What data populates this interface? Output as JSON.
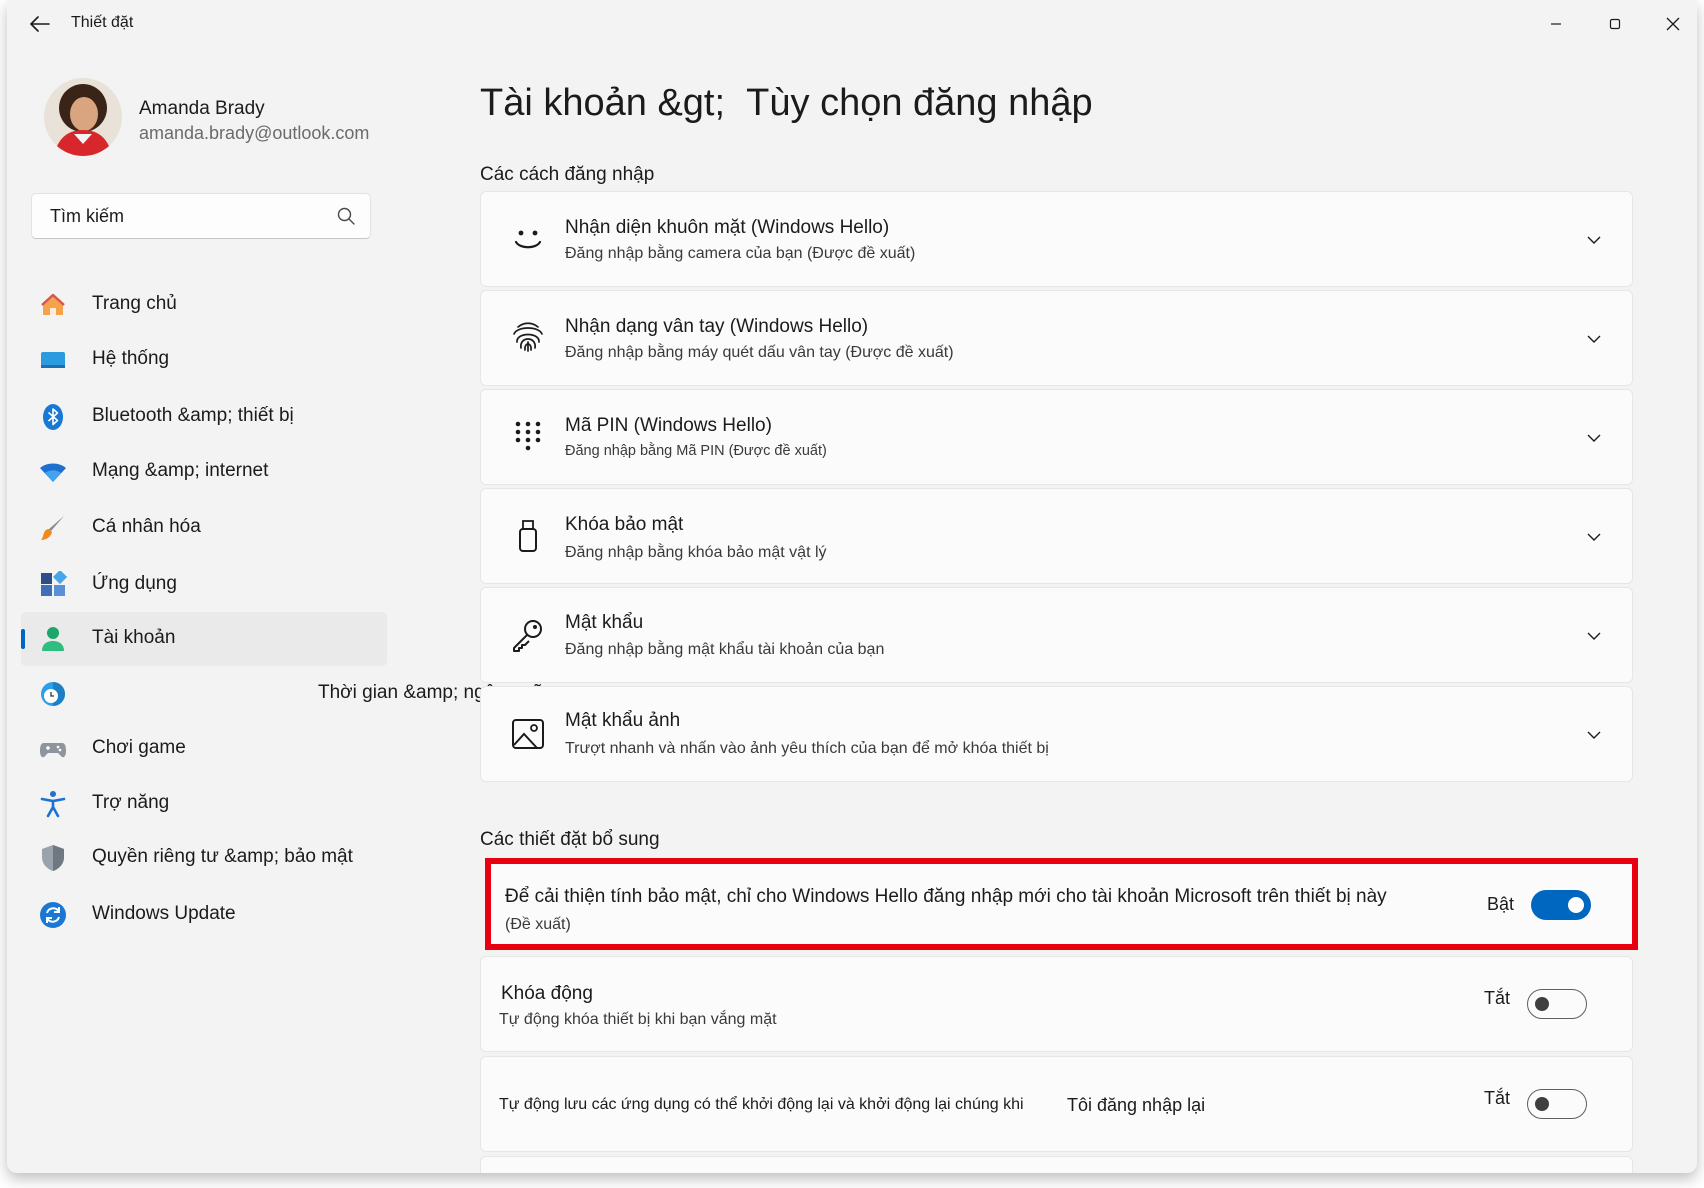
{
  "window": {
    "title": "Thiết đặt"
  },
  "profile": {
    "name": "Amanda Brady",
    "email": "amanda.brady@outlook.com"
  },
  "search": {
    "placeholder": "Tìm kiếm"
  },
  "nav": {
    "items": [
      {
        "label": "Trang chủ",
        "icon": "home-icon"
      },
      {
        "label": "Hệ thống",
        "icon": "system-icon"
      },
      {
        "label": "Bluetooth &amp; thiết bị",
        "icon": "bluetooth-icon"
      },
      {
        "label": "Mạng &amp; internet",
        "icon": "wifi-icon"
      },
      {
        "label": "Cá nhân hóa",
        "icon": "brush-icon"
      },
      {
        "label": "Ứng dụng",
        "icon": "apps-icon"
      },
      {
        "label": "Tài khoản",
        "icon": "account-icon",
        "active": true
      },
      {
        "label": "Thời gian &amp; ngôn ngữ",
        "icon": "time-language-icon"
      },
      {
        "label": "Chơi game",
        "icon": "gaming-icon"
      },
      {
        "label": "Trợ năng",
        "icon": "accessibility-icon"
      },
      {
        "label": "Quyền riêng tư &amp; bảo mật",
        "icon": "shield-icon"
      },
      {
        "label": "Windows Update",
        "icon": "update-icon"
      }
    ]
  },
  "main": {
    "breadcrumb_parent": "Tài khoản &gt;",
    "breadcrumb_current": "Tùy chọn đăng nhập",
    "signin_section_title": "Các cách đăng nhập",
    "signin_options": [
      {
        "title": "Nhận diện khuôn mặt (Windows Hello)",
        "subtitle": "Đăng nhập bằng camera của bạn (Được đề xuất)",
        "icon": "face-icon"
      },
      {
        "title": "Nhận dạng vân tay (Windows Hello)",
        "subtitle": "Đăng nhập bằng máy quét dấu vân tay (Được đề xuất)",
        "icon": "fingerprint-icon"
      },
      {
        "title": "Mã PIN (Windows Hello)",
        "subtitle": "Đăng nhập bằng  Mã PIN (Được đề xuất)",
        "icon": "pin-keypad-icon"
      },
      {
        "title": "Khóa bảo mật",
        "subtitle": "Đăng nhập bằng khóa bảo mật vật lý",
        "icon": "usb-key-icon"
      },
      {
        "title": "Mật khẩu",
        "subtitle": "Đăng nhập bằng mật khẩu tài khoản của bạn",
        "icon": "key-icon"
      },
      {
        "title": "Mật khẩu ảnh",
        "subtitle": "Trượt nhanh và nhấn vào ảnh yêu thích của bạn để mở khóa thiết bị",
        "icon": "picture-icon"
      }
    ],
    "additional_section_title": "Các thiết đặt bổ sung",
    "additional_settings": [
      {
        "title": "Để cải thiện tính bảo mật, chỉ cho Windows Hello đăng nhập mới cho tài khoản Microsoft trên thiết bị này",
        "subtitle": "(Đề xuất)",
        "state_label": "Bật",
        "on": true
      },
      {
        "title": "Khóa động",
        "subtitle": "Tự động khóa thiết bị khi bạn vắng mặt",
        "state_label": "Tắt",
        "on": false
      },
      {
        "title_part1": "Tự động lưu các ứng dụng có thể khởi động lại và khởi động lại chúng khi",
        "title_part2": "Tôi đăng nhập lại",
        "state_label": "Tắt",
        "on": false
      }
    ]
  },
  "colors": {
    "accent": "#0067c0",
    "highlight_border": "#e8000f",
    "window_bg": "#f3f3f3",
    "card_bg": "#fbfbfb"
  }
}
